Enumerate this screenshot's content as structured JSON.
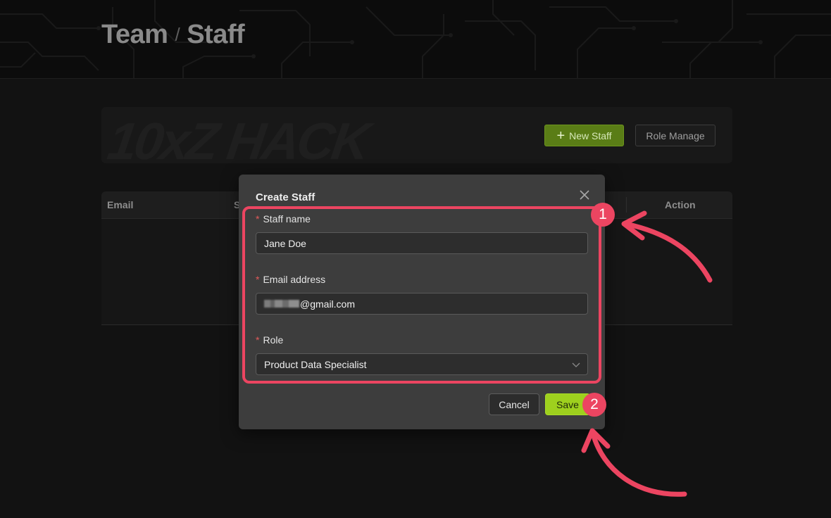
{
  "breadcrumb": {
    "parent": "Team",
    "separator": "/",
    "current": "Staff"
  },
  "banner": {
    "logo_text": "10xZ HACK"
  },
  "toolbar": {
    "new_staff_label": "New Staff",
    "role_manage_label": "Role Manage"
  },
  "table": {
    "headers": [
      "Email",
      "S",
      "Action"
    ]
  },
  "modal": {
    "title": "Create Staff",
    "fields": {
      "staff_name": {
        "label": "Staff name",
        "value": "Jane Doe"
      },
      "email": {
        "label": "Email address",
        "value_visible": "@gmail.com"
      },
      "role": {
        "label": "Role",
        "value": "Product Data Specialist"
      }
    },
    "required_marker": "*",
    "cancel_label": "Cancel",
    "save_label": "Save"
  },
  "annotations": {
    "step1": "1",
    "step2": "2"
  },
  "colors": {
    "accent_pink": "#ec4561",
    "save_green": "#9ed01e",
    "new_staff_green": "#5a7d16"
  }
}
